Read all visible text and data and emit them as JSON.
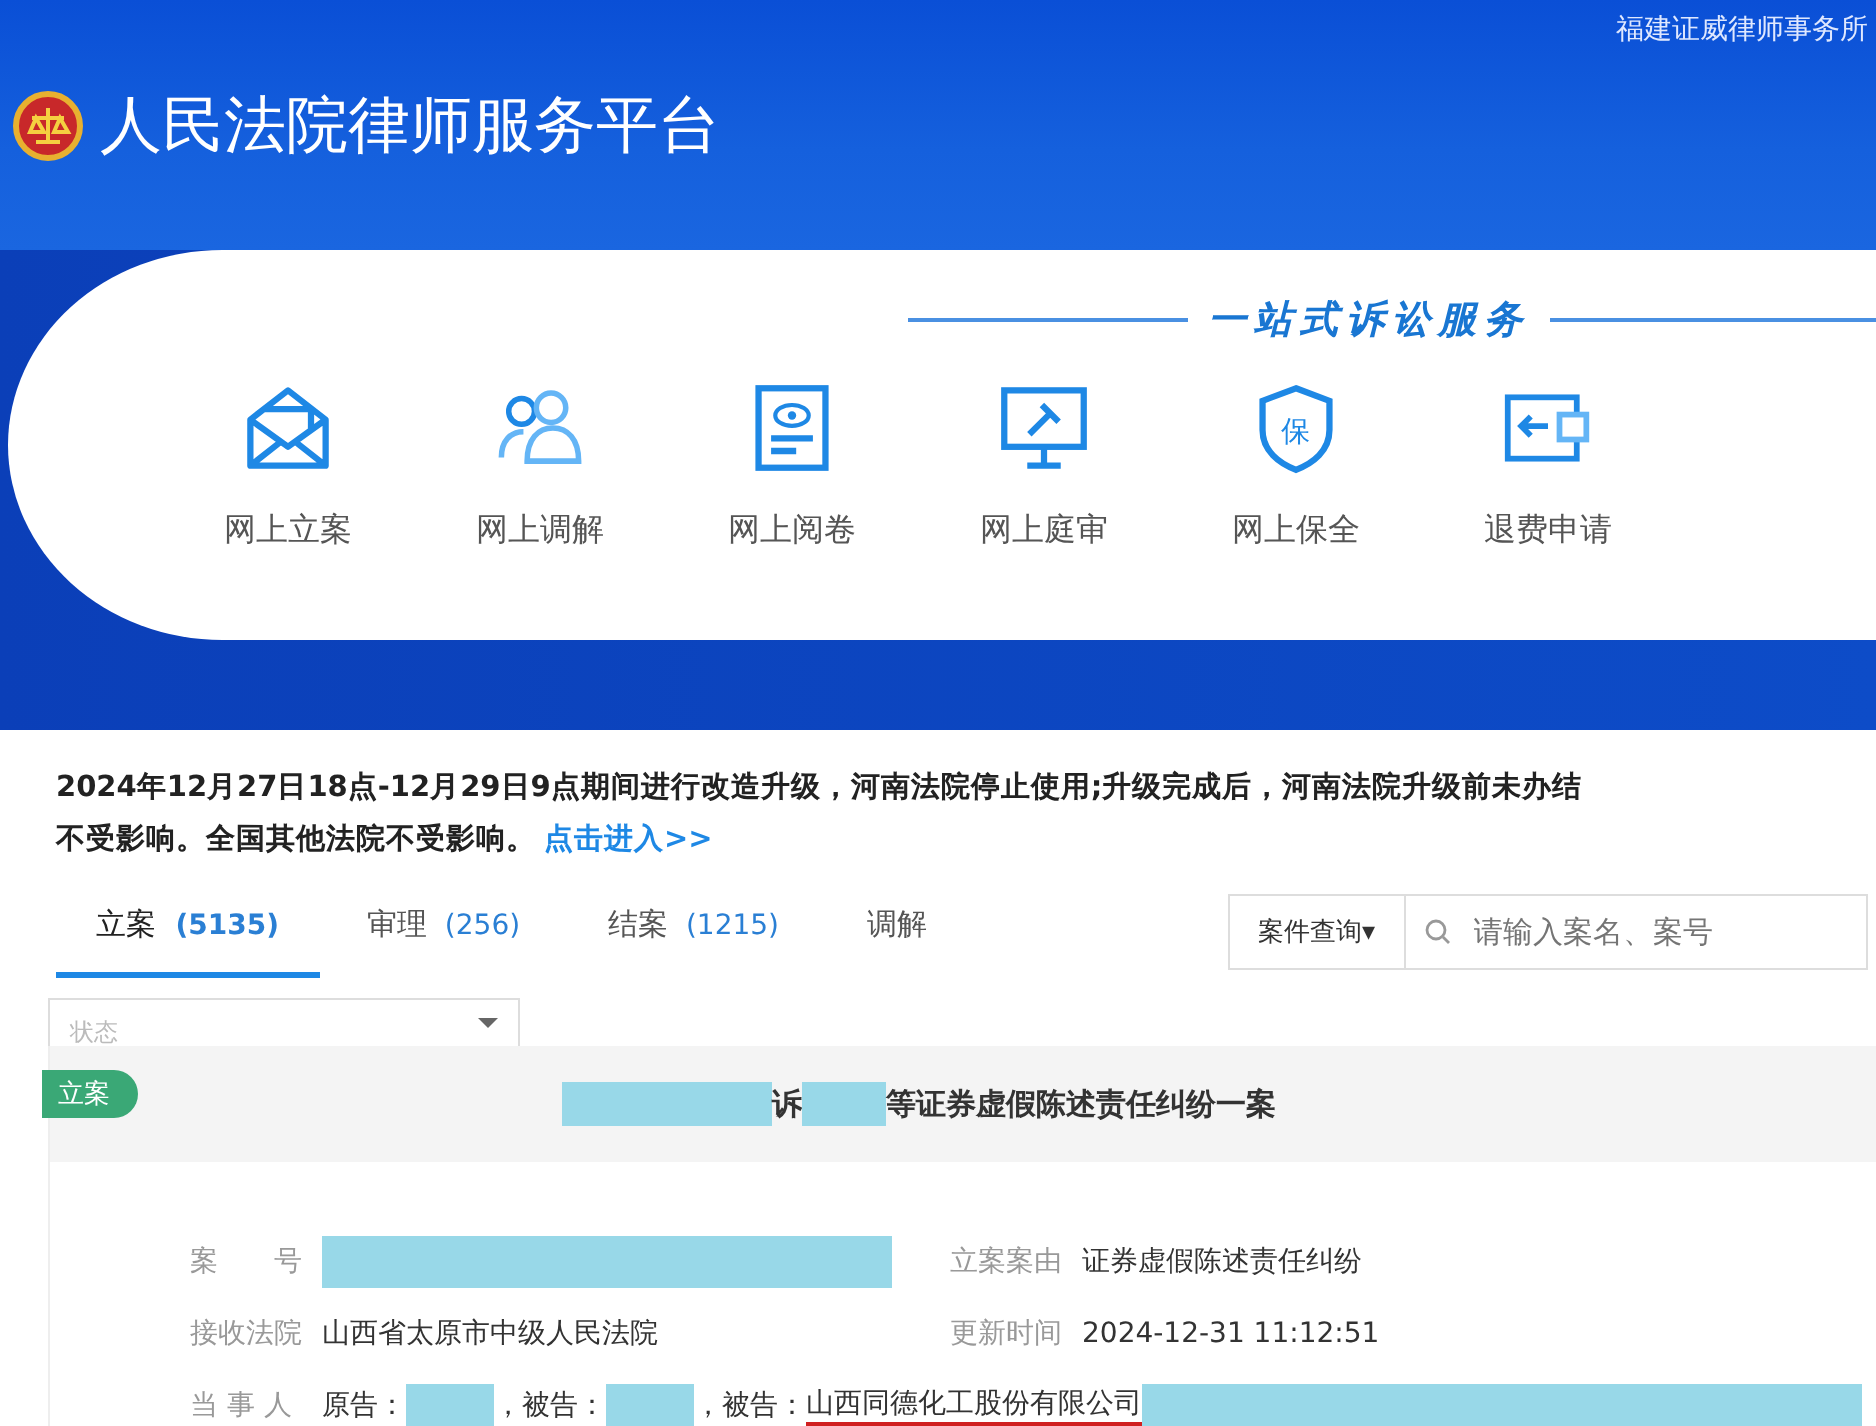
{
  "header": {
    "firm": "福建证威律师事务所",
    "title": "人民法院律师服务平台"
  },
  "services": {
    "heading": "一站式诉讼服务",
    "items": [
      {
        "kind": "envelope",
        "label": "网上立案"
      },
      {
        "kind": "people",
        "label": "网上调解"
      },
      {
        "kind": "document",
        "label": "网上阅卷"
      },
      {
        "kind": "monitor",
        "label": "网上庭审"
      },
      {
        "kind": "shield",
        "label": "网上保全",
        "badge": "保"
      },
      {
        "kind": "wallet",
        "label": "退费申请"
      }
    ]
  },
  "notice": {
    "lines": [
      "2024年12月27日18点-12月29日9点期间进行改造升级，河南法院停止使用;升级完成后，河南法院升级前未办结",
      "不受影响。全国其他法院不受影响。"
    ],
    "link": "点击进入>>"
  },
  "tabs": [
    {
      "label": "立案",
      "count": "(5135)",
      "selected": true
    },
    {
      "label": "审理",
      "count": "(256)",
      "selected": false
    },
    {
      "label": "结案",
      "count": "(1215)",
      "selected": false
    },
    {
      "label": "调解",
      "selected": false
    }
  ],
  "search": {
    "scope": "案件查询▾",
    "placeholder": "请输入案名、案号"
  },
  "status_filter": {
    "placeholder": "状态"
  },
  "case": {
    "status": "立案",
    "title_join": "诉",
    "title_rest": "等证券虚假陈述责任纠纷一案",
    "left_fields": [
      {
        "label": "案　　号",
        "kind": "redacted"
      },
      {
        "label": "接收法院",
        "kind": "text",
        "value": "山西省太原市中级人民法院"
      }
    ],
    "right_fields": [
      {
        "label": "立案案由",
        "value": "证券虚假陈述责任纠纷"
      },
      {
        "label": "更新时间",
        "value": "2024-12-31 11:12:51"
      }
    ],
    "parties_label": "当 事 人",
    "parties": [
      {
        "role": "原告："
      },
      {
        "role": "，被告："
      },
      {
        "role": "，被告：",
        "name": "山西同德化工股份有限公司"
      }
    ]
  }
}
